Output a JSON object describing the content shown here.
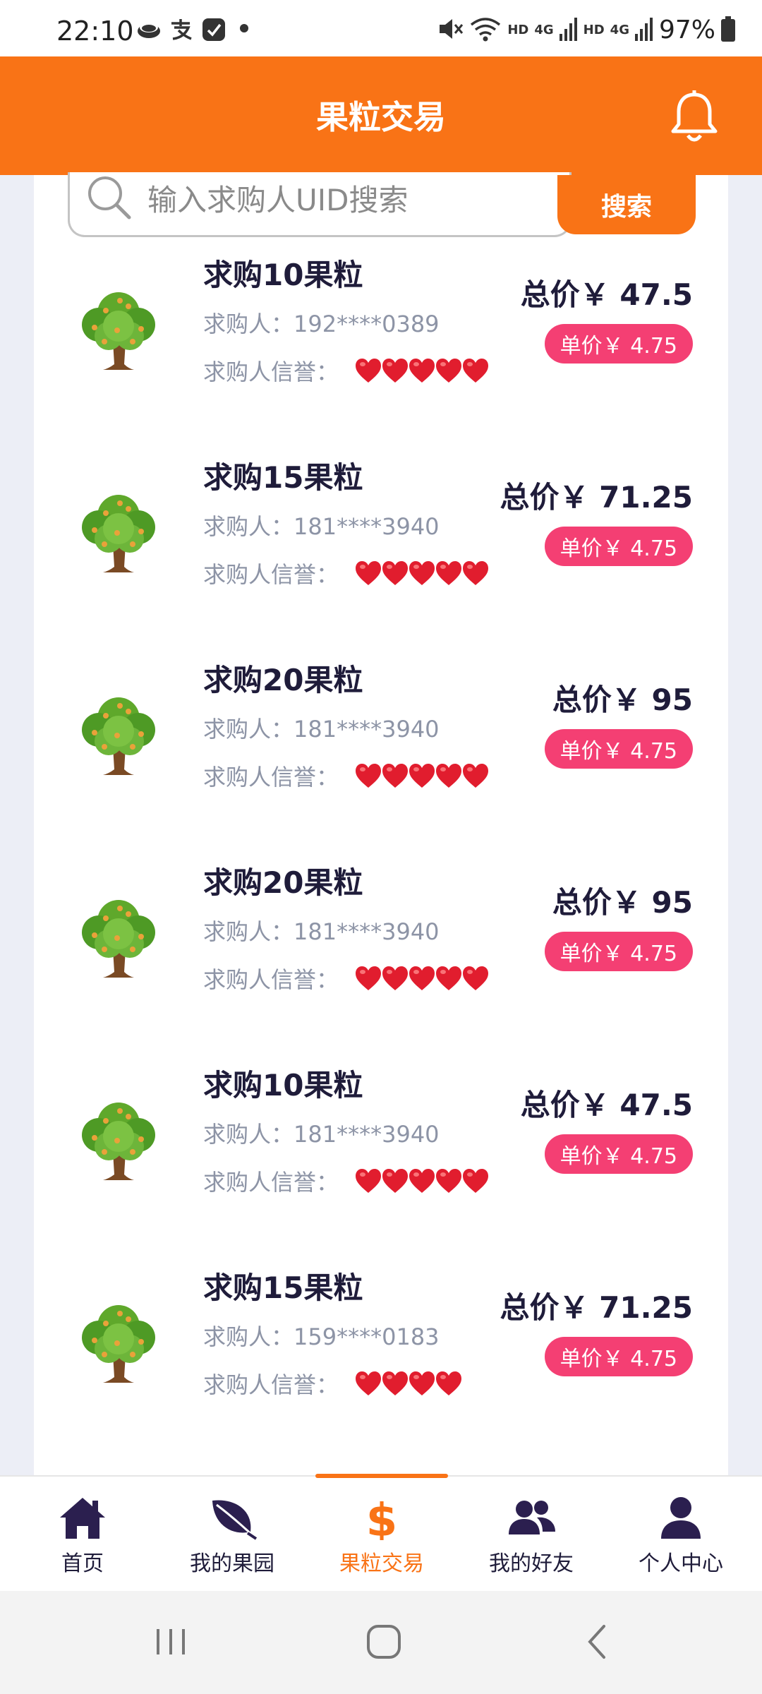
{
  "status_bar": {
    "time": "22:10",
    "network_labels": [
      "HD",
      "4G",
      "HD",
      "4G"
    ],
    "battery": "97%"
  },
  "header": {
    "title": "果粒交易",
    "bell_icon": "bell-icon"
  },
  "search": {
    "placeholder": "输入求购人UID搜索",
    "value": "",
    "button_label": "搜索"
  },
  "colors": {
    "accent": "#f97316",
    "badge": "#f43f73",
    "heart": "#e11d2e"
  },
  "orders": [
    {
      "title": "求购10果粒",
      "buyer_label": "求购人：",
      "buyer": "192****0389",
      "credit_label": "求购人信誉：",
      "hearts": 5,
      "total": "总价￥ 47.5",
      "unit": "单价￥ 4.75"
    },
    {
      "title": "求购15果粒",
      "buyer_label": "求购人：",
      "buyer": "181****3940",
      "credit_label": "求购人信誉：",
      "hearts": 5,
      "total": "总价￥ 71.25",
      "unit": "单价￥ 4.75"
    },
    {
      "title": "求购20果粒",
      "buyer_label": "求购人：",
      "buyer": "181****3940",
      "credit_label": "求购人信誉：",
      "hearts": 5,
      "total": "总价￥ 95",
      "unit": "单价￥ 4.75"
    },
    {
      "title": "求购20果粒",
      "buyer_label": "求购人：",
      "buyer": "181****3940",
      "credit_label": "求购人信誉：",
      "hearts": 5,
      "total": "总价￥ 95",
      "unit": "单价￥ 4.75"
    },
    {
      "title": "求购10果粒",
      "buyer_label": "求购人：",
      "buyer": "181****3940",
      "credit_label": "求购人信誉：",
      "hearts": 5,
      "total": "总价￥ 47.5",
      "unit": "单价￥ 4.75"
    },
    {
      "title": "求购15果粒",
      "buyer_label": "求购人：",
      "buyer": "159****0183",
      "credit_label": "求购人信誉：",
      "hearts": 4,
      "total": "总价￥ 71.25",
      "unit": "单价￥ 4.75"
    }
  ],
  "bottom_nav": {
    "items": [
      {
        "label": "首页",
        "icon": "home-icon"
      },
      {
        "label": "我的果园",
        "icon": "leaf-icon"
      },
      {
        "label": "果粒交易",
        "icon": "dollar-icon",
        "active": true
      },
      {
        "label": "我的好友",
        "icon": "friends-icon"
      },
      {
        "label": "个人中心",
        "icon": "user-icon"
      }
    ]
  }
}
